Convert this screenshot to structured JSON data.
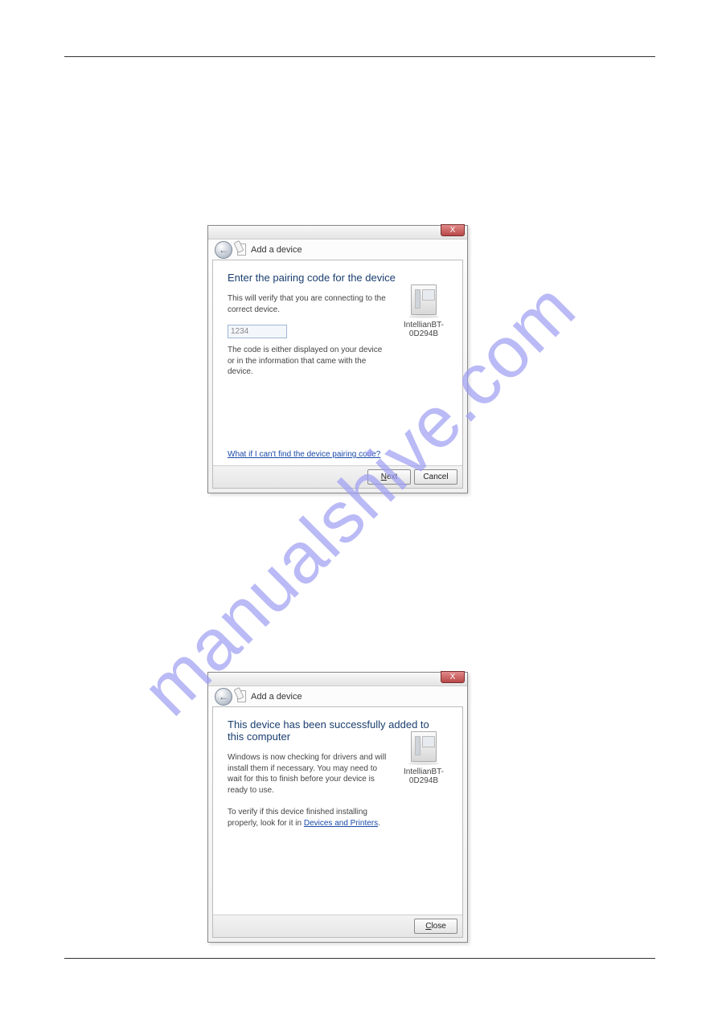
{
  "watermark": "manualshive.com",
  "common": {
    "header_title": "Add a device",
    "close_label": "X",
    "device_name": "IntellianBT-0D294B"
  },
  "dialog1": {
    "headline": "Enter the pairing code for the device",
    "subtitle": "This will verify that you are connecting to the correct device.",
    "code_value": "1234",
    "hint": "The code is either displayed on your device or in the information that came with the device.",
    "help_link": "What if I can't find the device pairing code?",
    "next_label": "Next",
    "cancel_label": "Cancel"
  },
  "dialog2": {
    "headline": "This device has been successfully added to this computer",
    "body1": "Windows is now checking for drivers and will install them if necessary. You may need to wait for this to finish before your device is ready to use.",
    "verify_prefix": "To verify if this device finished installing properly, look for it in ",
    "verify_link": "Devices and Printers",
    "verify_suffix": ".",
    "close_label": "Close"
  }
}
